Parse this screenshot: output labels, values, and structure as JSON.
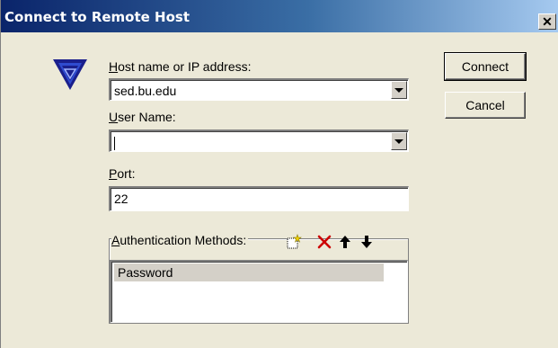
{
  "window": {
    "title": "Connect to Remote Host",
    "close_glyph": "✕"
  },
  "logo": {
    "icon": "ssh-logo-icon",
    "color": "#1a1f8c"
  },
  "host": {
    "label_accel": "H",
    "label_rest": "ost name or IP address:",
    "value": "sed.bu.edu"
  },
  "user": {
    "label_accel": "U",
    "label_rest": "ser Name:",
    "value": ""
  },
  "port": {
    "label_accel": "P",
    "label_rest": "ort:",
    "value": "22"
  },
  "buttons": {
    "connect": "Connect",
    "cancel": "Cancel"
  },
  "auth": {
    "label_accel": "A",
    "label_rest": "uthentication Methods:",
    "methods": [
      "Password"
    ],
    "tools": [
      "new-method-icon",
      "delete-icon",
      "move-up-icon",
      "move-down-icon"
    ],
    "delete_color": "#cc0000"
  }
}
